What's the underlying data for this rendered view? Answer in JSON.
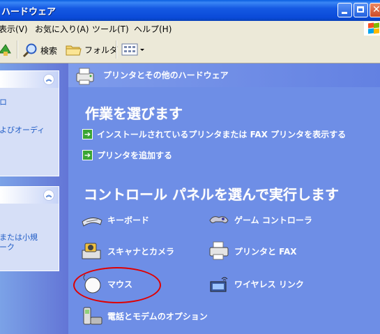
{
  "window": {
    "title": "ハードウェア"
  },
  "menu": {
    "items": [
      "表示(V)",
      "お気に入り(A)",
      "ツール(T)",
      "ヘルプ(H)"
    ]
  },
  "toolbar": {
    "search_label": "検索",
    "folders_label": "フォルダ"
  },
  "left_pane": {
    "panel1": {
      "links": [
        "ロ",
        "よびオーディ"
      ]
    },
    "panel2": {
      "links": [
        "または小規",
        "ーク"
      ]
    }
  },
  "main": {
    "header": "プリンタとその他のハードウェア",
    "pick_task_title": "作業を選びます",
    "tasks": [
      "インストールされているプリンタまたは FAX プリンタを表示する",
      "プリンタを追加する"
    ],
    "pick_icon_title": "コントロール パネルを選んで実行します",
    "items": [
      "キーボード",
      "ゲーム コントローラ",
      "スキャナとカメラ",
      "プリンタと FAX",
      "マウス",
      "ワイヤレス リンク",
      "電話とモデムのオプション"
    ]
  },
  "colors": {
    "accent_red": "#e00000",
    "pane_blue": "#6e8ee6",
    "title_blue": "#0a4ad8"
  }
}
